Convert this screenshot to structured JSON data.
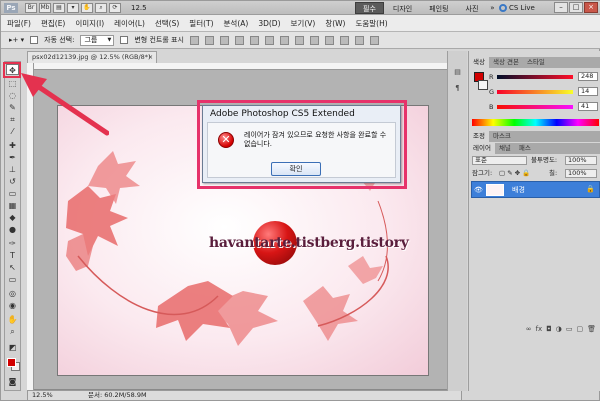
{
  "appbar": {
    "logo": "Ps",
    "zoom": "12.5",
    "workspaces": [
      "필수",
      "디자인",
      "페인팅",
      "사진"
    ],
    "workspaces_more": "»",
    "cs_live": "CS Live",
    "window_buttons": [
      "–",
      "□",
      "×"
    ]
  },
  "menu": [
    "파일(F)",
    "편집(E)",
    "이미지(I)",
    "레이어(L)",
    "선택(S)",
    "필터(T)",
    "분석(A)",
    "3D(D)",
    "보기(V)",
    "창(W)",
    "도움말(H)"
  ],
  "options": {
    "auto_select_label": "자동 선택:",
    "auto_select_value": "그룹",
    "transform_label": "변형 컨트롤 표시"
  },
  "document": {
    "tab_title": "psx02d12139.jpg @ 12.5% (RGB/8*)",
    "tab_close": "×",
    "status_zoom": "12.5%",
    "status_doc": "문서: 60.2M/58.9M",
    "watermark": "havantarte.tistberg.tistory"
  },
  "dialog": {
    "title": "Adobe Photoshop CS5 Extended",
    "message": "레이어가 잠겨 있으므로 요청한 사항을 완료할 수 없습니다.",
    "ok_label": "확인"
  },
  "color_panel": {
    "tabs": [
      "색상",
      "색상 견본",
      "스타일"
    ],
    "r_label": "R",
    "g_label": "G",
    "b_label": "B",
    "r_value": "248",
    "g_value": "14",
    "b_value": "41"
  },
  "adjust_panel": {
    "tabs": [
      "조정",
      "마스크"
    ]
  },
  "layers_panel": {
    "tabs": [
      "레이어",
      "채널",
      "패스"
    ],
    "blend_mode": "표준",
    "opacity_label": "불투명도:",
    "opacity_value": "100%",
    "lock_label": "잠그기:",
    "fill_label": "칠:",
    "fill_value": "100%",
    "layer_name": "배경"
  },
  "colors": {
    "accent_highlight": "#e4324f",
    "foreground": "#d10000",
    "selection": "#3d7fd9"
  }
}
